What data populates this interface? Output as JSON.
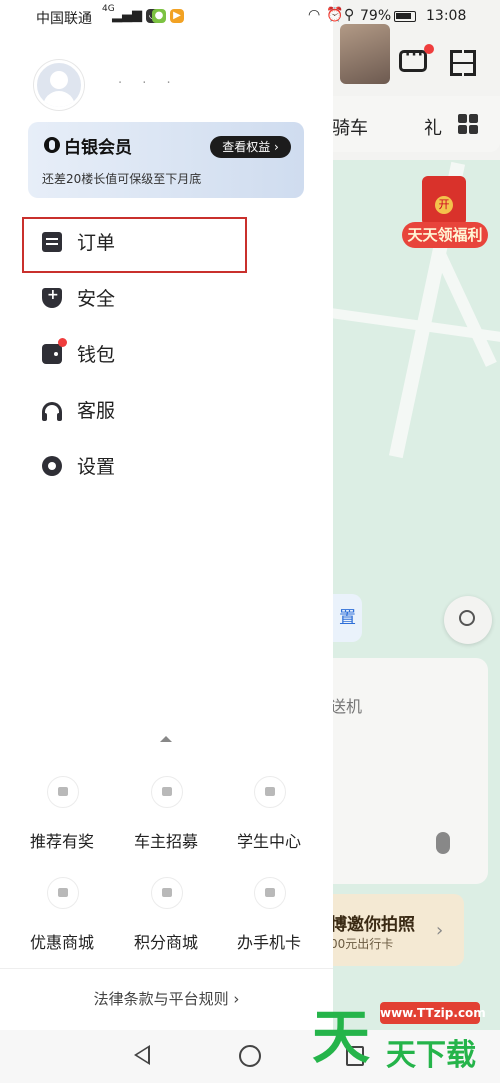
{
  "status_bar": {
    "carrier": "中国联通",
    "network": "4G",
    "battery": "79%",
    "time": "13:08"
  },
  "user": {
    "name_masked": "· · ·"
  },
  "membership": {
    "title": "白银会员",
    "button": "查看权益 ›",
    "subtitle": "还差20楼长值可保级至下月底"
  },
  "menu": [
    {
      "label": "订单",
      "icon": "order-icon"
    },
    {
      "label": "安全",
      "icon": "shield-icon"
    },
    {
      "label": "钱包",
      "icon": "wallet-icon"
    },
    {
      "label": "客服",
      "icon": "headset-icon"
    },
    {
      "label": "设置",
      "icon": "gear-icon"
    }
  ],
  "services": [
    {
      "label": "推荐有奖",
      "icon": "gift-icon"
    },
    {
      "label": "车主招募",
      "icon": "driver-icon"
    },
    {
      "label": "学生中心",
      "icon": "graduation-icon"
    },
    {
      "label": "优惠商城",
      "icon": "coupon-icon"
    },
    {
      "label": "积分商城",
      "icon": "cart-icon"
    },
    {
      "label": "办手机卡",
      "icon": "sim-card-icon"
    }
  ],
  "footer": {
    "link": "法律条款与平台规则 ›"
  },
  "background": {
    "tab_visible": "骑车",
    "tab_partial": "礼",
    "red_packet_badge": "开",
    "red_packet_label": "天天领福利",
    "chip_text": "置",
    "card_text": "送机",
    "banner_title": "博邀你拍照",
    "banner_sub": "00元出行卡"
  },
  "watermark": {
    "url": "www.TTzip.com",
    "big": "天",
    "text": "天下载"
  },
  "colors": {
    "highlight_border": "#c9302c",
    "notification_dot": "#ef3d3d",
    "membership_gradient_start": "#e7eef8",
    "membership_gradient_end": "#cfdcef",
    "map_bg": "#dceee4"
  }
}
